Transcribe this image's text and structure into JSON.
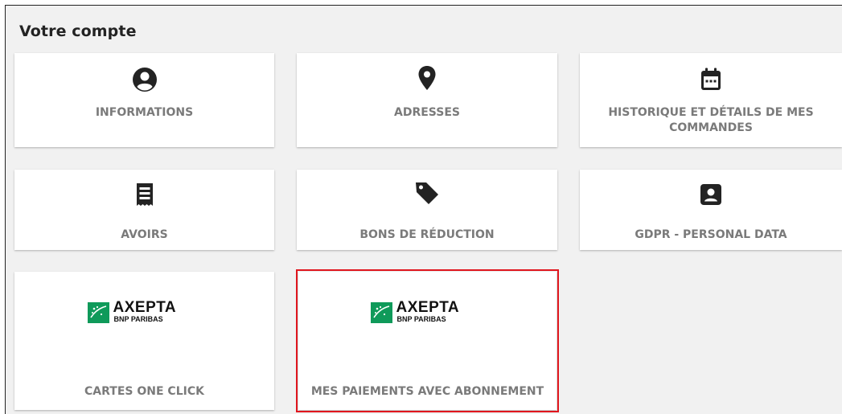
{
  "page": {
    "title": "Votre compte"
  },
  "cards": [
    {
      "id": "informations",
      "label": "INFORMATIONS",
      "icon": "user-circle-icon"
    },
    {
      "id": "adresses",
      "label": "ADRESSES",
      "icon": "map-pin-icon"
    },
    {
      "id": "historique",
      "label": "HISTORIQUE ET DÉTAILS DE MES COMMANDES",
      "icon": "calendar-icon"
    },
    {
      "id": "avoirs",
      "label": "AVOIRS",
      "icon": "receipt-icon"
    },
    {
      "id": "bons",
      "label": "BONS DE RÉDUCTION",
      "icon": "tag-icon"
    },
    {
      "id": "gdpr",
      "label": "GDPR - PERSONAL DATA",
      "icon": "user-badge-icon"
    },
    {
      "id": "cartes",
      "label": "CARTES ONE CLICK",
      "icon": "axepta-logo"
    },
    {
      "id": "paiements",
      "label": "MES PAIEMENTS AVEC ABONNEMENT",
      "icon": "axepta-logo",
      "highlighted": true
    }
  ],
  "logo": {
    "brand": "AXEPTA",
    "sub": "BNP PARIBAS"
  },
  "colors": {
    "background": "#f1f1f1",
    "card": "#ffffff",
    "label": "#7a7a7a",
    "highlight": "#e0161e",
    "brand_green": "#0f9a5a"
  }
}
